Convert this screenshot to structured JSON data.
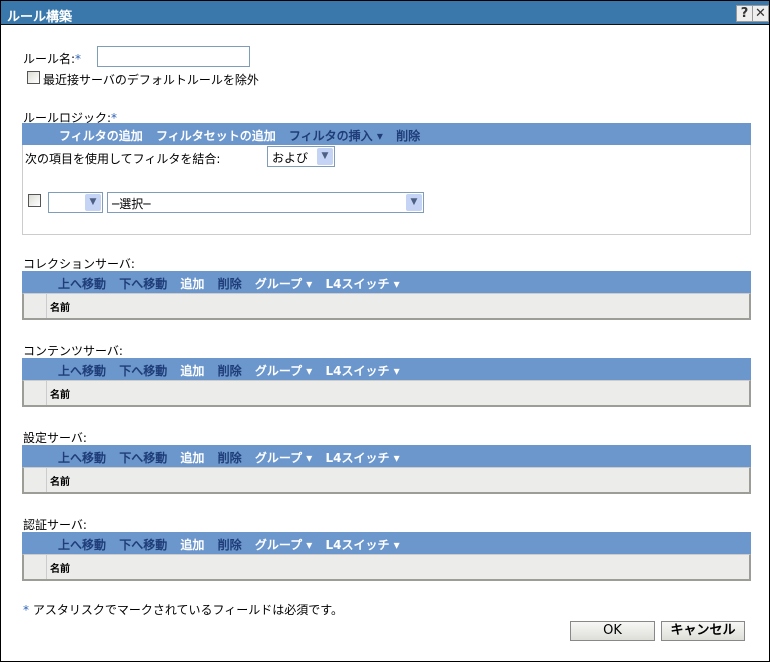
{
  "window": {
    "title": "ルール構築",
    "help": "?",
    "close": "✕"
  },
  "rule_name": {
    "label": "ルール名:",
    "required": "*",
    "value": ""
  },
  "exclude_default": {
    "label": "最近接サーバのデフォルトルールを除外",
    "checked": false
  },
  "rule_logic": {
    "label": "ルールロジック:",
    "required": "*",
    "toolbar": [
      "フィルタの追加",
      "フィルタセットの追加",
      "フィルタの挿入 ▾",
      "削除"
    ],
    "combine_label": "次の項目を使用してフィルタを結合:",
    "combine_value": "および",
    "filter_row": {
      "checked": false,
      "op_value": "",
      "field_value": "─選択─"
    }
  },
  "server_toolbar": [
    "上へ移動",
    "下へ移動",
    "追加",
    "削除",
    "グループ ▾",
    "L4スイッチ ▾"
  ],
  "sections": [
    {
      "label": "コレクションサーバ:",
      "column": "名前"
    },
    {
      "label": "コンテンツサーバ:",
      "column": "名前"
    },
    {
      "label": "設定サーバ:",
      "column": "名前"
    },
    {
      "label": "認証サーバ:",
      "column": "名前"
    }
  ],
  "footnote": {
    "star": "*",
    "text": "アスタリスクでマークされているフィールドは必須です。"
  },
  "buttons": {
    "ok": "OK",
    "cancel": "キャンセル"
  }
}
